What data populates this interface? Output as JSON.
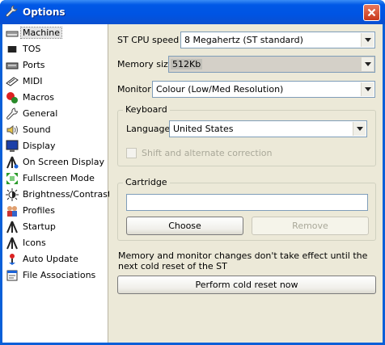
{
  "window": {
    "title": "Options"
  },
  "sidebar": {
    "items": [
      {
        "label": "Machine",
        "icon": "machine-icon",
        "selected": true
      },
      {
        "label": "TOS",
        "icon": "tos-chip-icon"
      },
      {
        "label": "Ports",
        "icon": "ports-icon"
      },
      {
        "label": "MIDI",
        "icon": "midi-icon"
      },
      {
        "label": "Macros",
        "icon": "macros-icon"
      },
      {
        "label": "General",
        "icon": "general-icon"
      },
      {
        "label": "Sound",
        "icon": "sound-icon"
      },
      {
        "label": "Display",
        "icon": "display-icon"
      },
      {
        "label": "On Screen Display",
        "icon": "on-screen-display-icon"
      },
      {
        "label": "Fullscreen Mode",
        "icon": "fullscreen-icon"
      },
      {
        "label": "Brightness/Contrast",
        "icon": "brightness-icon"
      },
      {
        "label": "Profiles",
        "icon": "profiles-icon"
      },
      {
        "label": "Startup",
        "icon": "startup-icon"
      },
      {
        "label": "Icons",
        "icon": "icons-icon"
      },
      {
        "label": "Auto Update",
        "icon": "auto-update-icon"
      },
      {
        "label": "File Associations",
        "icon": "file-associations-icon"
      }
    ]
  },
  "machine": {
    "cpu_speed_label": "ST CPU speed",
    "cpu_speed_value": "8 Megahertz (ST standard)",
    "memory_label": "Memory size",
    "memory_value": "512Kb",
    "monitor_label": "Monitor",
    "monitor_value": "Colour (Low/Med Resolution)"
  },
  "keyboard": {
    "group_title": "Keyboard",
    "language_label": "Language",
    "language_value": "United States",
    "shift_correction_label": "Shift and alternate correction"
  },
  "cartridge": {
    "group_title": "Cartridge",
    "path_value": "",
    "choose_label": "Choose",
    "remove_label": "Remove"
  },
  "footer": {
    "note": "Memory and monitor changes don't take effect until the next cold reset of the ST",
    "reset_label": "Perform cold reset now"
  },
  "colors": {
    "titlebar": "#0054e3",
    "window_bg": "#ece9d8",
    "close": "#c8381b"
  }
}
